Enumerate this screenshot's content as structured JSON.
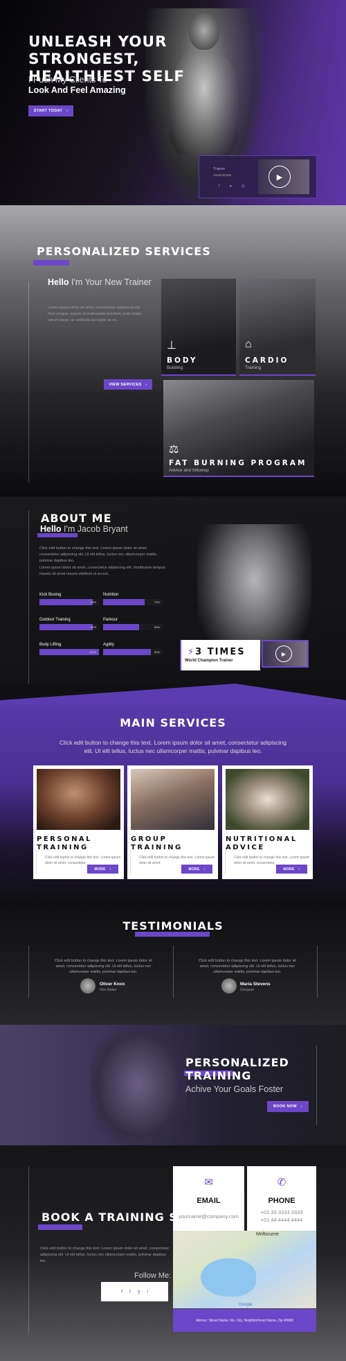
{
  "hero": {
    "title": "UNLEASH YOUR STRONGEST, HEALTHIEST SELF",
    "subtitle_line1": "I Push My Clients To",
    "subtitle_line2": "Look And Feel Amazing",
    "cta": "START TODAY",
    "video_card": {
      "label": "Trainer",
      "sublabel": "Jacob Bryant"
    }
  },
  "personalized_services": {
    "heading": "PERSONALIZED SERVICES",
    "hello": "Hello",
    "hello_rest": "I'm Your New Trainer",
    "paragraph": "Lorem ipsum dolor sit amet, consectetur adipiscing elit. Sed congue, mauris ut malesuada tincidunt, enim turpis rutrum lacus, ac vehicula dui turpis ac ex.",
    "button": "VIEW SERVICES",
    "tiles": [
      {
        "title": "BODY",
        "subtitle": "Building",
        "icon": "bench-icon"
      },
      {
        "title": "CARDIO",
        "subtitle": "Training",
        "icon": "treadmill-icon"
      },
      {
        "title": "FAT BURNING PROGRAM",
        "subtitle": "Advice and followup",
        "icon": "scale-icon"
      }
    ]
  },
  "about": {
    "heading": "ABOUT ME",
    "hello": "Hello",
    "hello_rest": "I'm Jacob Bryant",
    "p1": "Click edit button to change this text. Lorem ipsum dolor sit amet, consectetur adipiscing elit. Ut elit tellus, luctus nec ullamcorper mattis, pulvinar dapibus leo.",
    "p2": "Lorem ipsum dolor sit amet, consectetur adipiscing elit. Vestibulum tempus mauris sit amet mauris eleifend ut eu est.",
    "skills": [
      {
        "label": "Kick Boxing",
        "value": 90,
        "pct": "90%"
      },
      {
        "label": "Nutrition",
        "value": 70,
        "pct": "70%"
      },
      {
        "label": "Outdoor Training",
        "value": 90,
        "pct": "90%"
      },
      {
        "label": "Parkour",
        "value": 60,
        "pct": "60%"
      },
      {
        "label": "Body Lifting",
        "value": 100,
        "pct": "100%"
      },
      {
        "label": "Agility",
        "value": 80,
        "pct": "80%"
      }
    ],
    "champ_title": "3 TIMES",
    "champ_sub": "World Champion Trainer"
  },
  "main_services": {
    "heading": "MAIN SERVICES",
    "intro": "Click edit button to change this text. Lorem ipsum dolor sit amet, consectetur adipiscing elit. Ut elit tellus, luctus nec ullamcorper mattis, pulvinar dapibus leo.",
    "cards": [
      {
        "title": "PERSONAL TRAINING",
        "text": "Click edit button to change this text. Lorem ipsum dolor sit amet, consectetur.",
        "button": "MORE"
      },
      {
        "title": "GROUP TRAINING",
        "text": "Click edit button to change this text. Lorem ipsum dolor sit amet.",
        "button": "MORE"
      },
      {
        "title": "NUTRITIONAL ADVICE",
        "text": "Click edit button to change this text. Lorem ipsum dolor sit amet, consectetur.",
        "button": "MORE"
      }
    ]
  },
  "testimonials": {
    "heading": "TESTIMONIALS",
    "items": [
      {
        "quote": "Click edit button to change this text. Lorem ipsum dolor sit amet, consectetur adipiscing elit. Ut elit tellus, luctus nec ullamcorper mattis, pulvinar dapibus leo.",
        "name": "Oliver Knox",
        "role": "Film Maker"
      },
      {
        "quote": "Click edit button to change this text. Lorem ipsum dolor sit amet, consectetur adipiscing elit. Ut elit tellus, luctus nec ullamcorper mattis, pulvinar dapibus leo.",
        "name": "Maria Stevens",
        "role": "Designer"
      }
    ]
  },
  "personalized_training": {
    "heading": "PERSONALIZED TRAINING",
    "sub": "Achive Your Goals Foster",
    "button": "BOOK NOW"
  },
  "book": {
    "heading": "BOOK A TRAINING SESSION",
    "paragraph": "Click edit button to change this text. Lorem ipsum dolor sit amet, consectetur adipiscing elit. Ut elit tellus, luctus nec ullamcorper mattis, pulvinar dapibus leo.",
    "follow": "Follow Me:",
    "social": [
      "f",
      "t",
      "y",
      "i"
    ],
    "email_title": "EMAIL",
    "email_value": "yourname@company.com",
    "phone_title": "PHONE",
    "phone_1": "+01 33 3333 3333",
    "phone_2": "+01 44 4444 4444",
    "map_city": "Melbourne",
    "map_brand": "Google",
    "address": "Adress: Street Name, No, City, Neighborhood Name, Zip 40680"
  },
  "colors": {
    "accent": "#6b47c9"
  }
}
